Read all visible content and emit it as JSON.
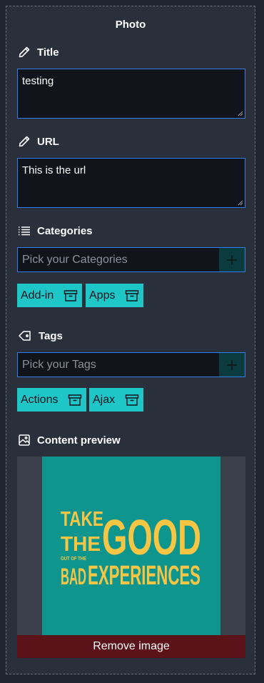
{
  "panel": {
    "title": "Photo"
  },
  "title_field": {
    "label": "Title",
    "value": "testing"
  },
  "url_field": {
    "label": "URL",
    "value": "This is the url"
  },
  "categories": {
    "label": "Categories",
    "placeholder": "Pick your Categories",
    "chips": [
      "Add-in",
      "Apps"
    ]
  },
  "tags": {
    "label": "Tags",
    "placeholder": "Pick your Tags",
    "chips": [
      "Actions",
      "Ajax"
    ]
  },
  "preview": {
    "label": "Content preview",
    "image_text": {
      "take": "TAKE",
      "the": "THE",
      "good": "GOOD",
      "out_of_the": "OUT OF THE",
      "bad": "BAD",
      "experiences": "EXPERIENCES"
    },
    "remove_label": "Remove image"
  },
  "colors": {
    "accent_border": "#2f80ed",
    "chip_bg": "#1fc6c8",
    "poster_bg": "#0e968e",
    "poster_text": "#f6c544",
    "remove_bg": "#5b1219"
  },
  "icons": {
    "title": "pencil-icon",
    "url": "pencil-icon",
    "categories": "list-icon",
    "tags": "tag-icon",
    "preview": "image-icon",
    "add": "plus-icon",
    "chip_remove": "archive-icon"
  }
}
